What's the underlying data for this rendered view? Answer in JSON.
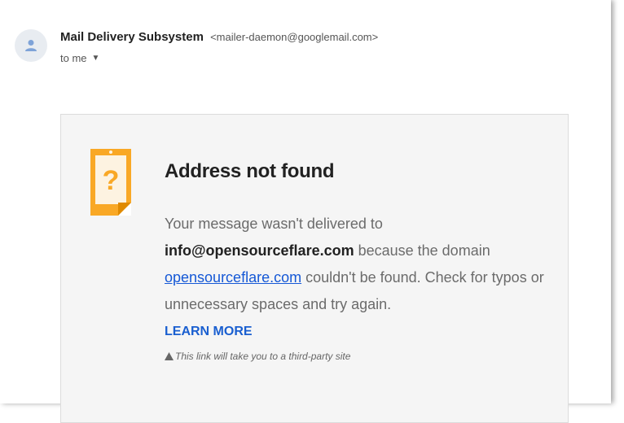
{
  "sender": {
    "name": "Mail Delivery Subsystem",
    "email": "<mailer-daemon@googlemail.com>",
    "recipient_label": "to me",
    "avatar_icon": "person-icon"
  },
  "bounce_card": {
    "icon": "question-mark-icon",
    "title": "Address not found",
    "message_prefix": "Your message wasn't delivered to ",
    "failed_address": "info@opensourceflare.com",
    "message_mid": " because the domain ",
    "domain_link": "opensourceflare.com",
    "message_suffix": " couldn't be found. Check for typos or unnecessary spaces and try again.",
    "learn_more_label": "LEARN MORE",
    "third_party_note": "This link will take you to a third-party site"
  },
  "colors": {
    "link": "#1558d6",
    "learn_more": "#1a5fd0",
    "icon_orange": "#f9a825",
    "card_bg": "#f5f5f5"
  }
}
